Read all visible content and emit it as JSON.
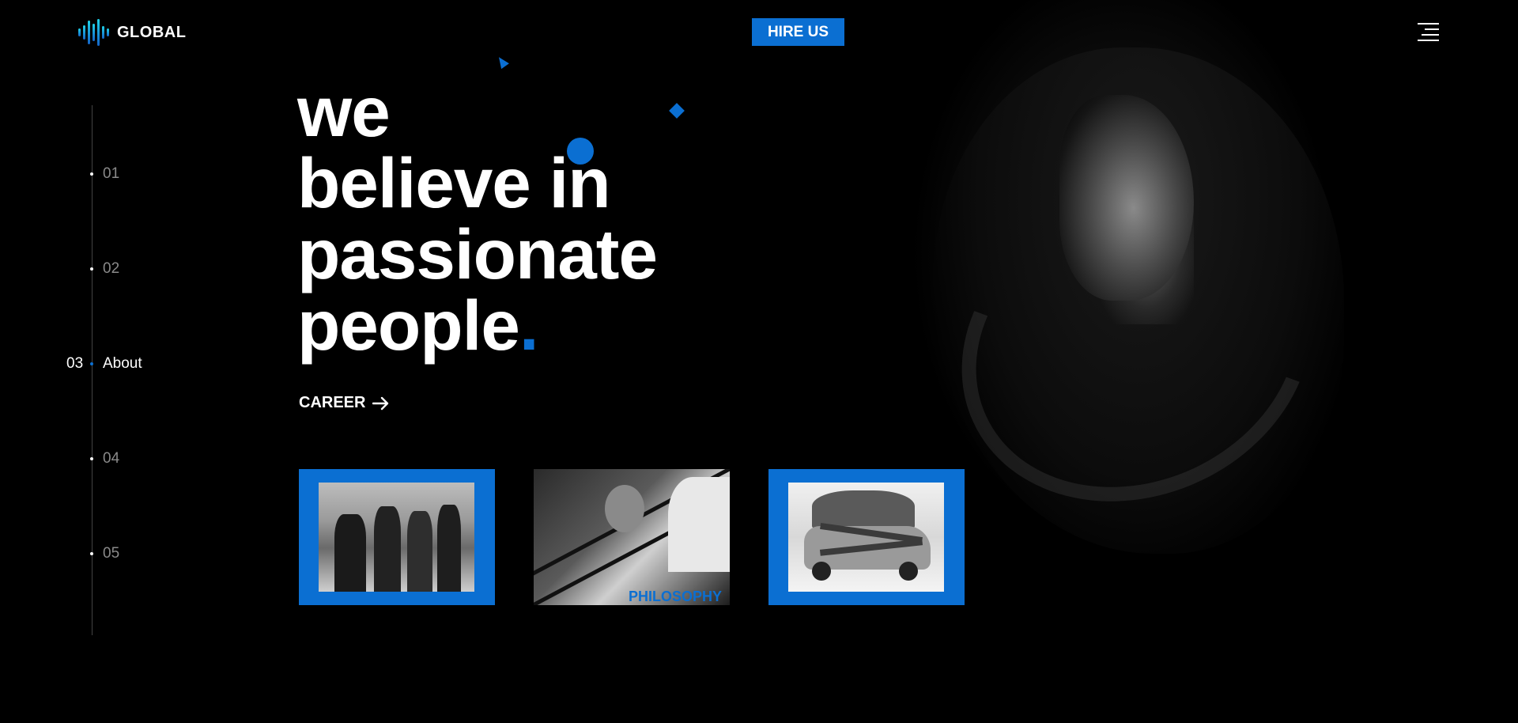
{
  "brand": {
    "name": "GLOBAL",
    "icon": "soundwave-logo-icon",
    "accent": "#0b6fd2"
  },
  "header": {
    "cta_label": "HIRE US",
    "menu_icon": "hamburger-menu-icon"
  },
  "side_nav": {
    "items": [
      {
        "number": "01"
      },
      {
        "number": "02"
      },
      {
        "number": "03",
        "label": "About",
        "active": true
      },
      {
        "number": "04"
      },
      {
        "number": "05"
      }
    ]
  },
  "hero": {
    "lines": [
      "we",
      "believe in",
      "passionate",
      "people"
    ],
    "period": ".",
    "career_label": "CAREER",
    "career_icon": "arrow-right-icon"
  },
  "thumbnails": [
    {
      "image": "street-photo"
    },
    {
      "image": "boxing-photo",
      "label": "PHILOSOPHY"
    },
    {
      "image": "surfers-on-car-photo"
    }
  ]
}
